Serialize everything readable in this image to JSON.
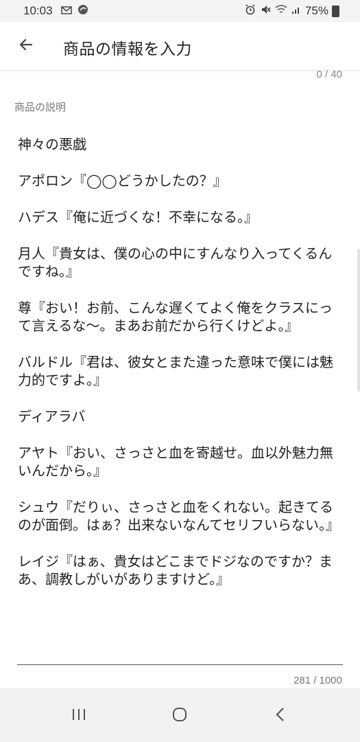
{
  "status_bar": {
    "time": "10:03",
    "battery": "75%",
    "icons_left": [
      "mail-icon",
      "app-notification-icon"
    ],
    "icons_right": [
      "alarm-icon",
      "mute-icon",
      "wifi-icon",
      "signal-icon",
      "battery-icon"
    ]
  },
  "app_bar": {
    "title": "商品の情報を入力"
  },
  "title_field": {
    "counter": "0 / 40"
  },
  "description": {
    "label": "商品の説明",
    "paragraphs": [
      "神々の悪戯",
      "アポロン『◯◯どうかしたの？』",
      "ハデス『俺に近づくな！不幸になる。』",
      "月人『貴女は、僕の心の中にすんなり入ってくるんですね。』",
      "尊『おい！お前、こんな遅くてよく俺をクラスにって言えるな〜。まあお前だから行くけどよ。』",
      "バルドル『君は、彼女とまた違った意味で僕には魅力的ですよ。』",
      "ディアラバ",
      "アヤト『おい、さっさと血を寄越せ。血以外魅力無いんだから。』",
      "シュウ『だりぃ、さっさと血をくれない。起きてるのが面倒。はぁ？出来ないなんてセリフいらない。』",
      "レイジ『はぁ、貴女はどこまでドジなのですか？まあ、調教しがいがありますけど。』"
    ],
    "counter": "281 / 1000"
  },
  "colors": {
    "background": "#ffffff",
    "status_bar": "#f4f4f4",
    "nav_bar": "#f2f2f2",
    "text": "#222222",
    "muted": "#888888"
  }
}
